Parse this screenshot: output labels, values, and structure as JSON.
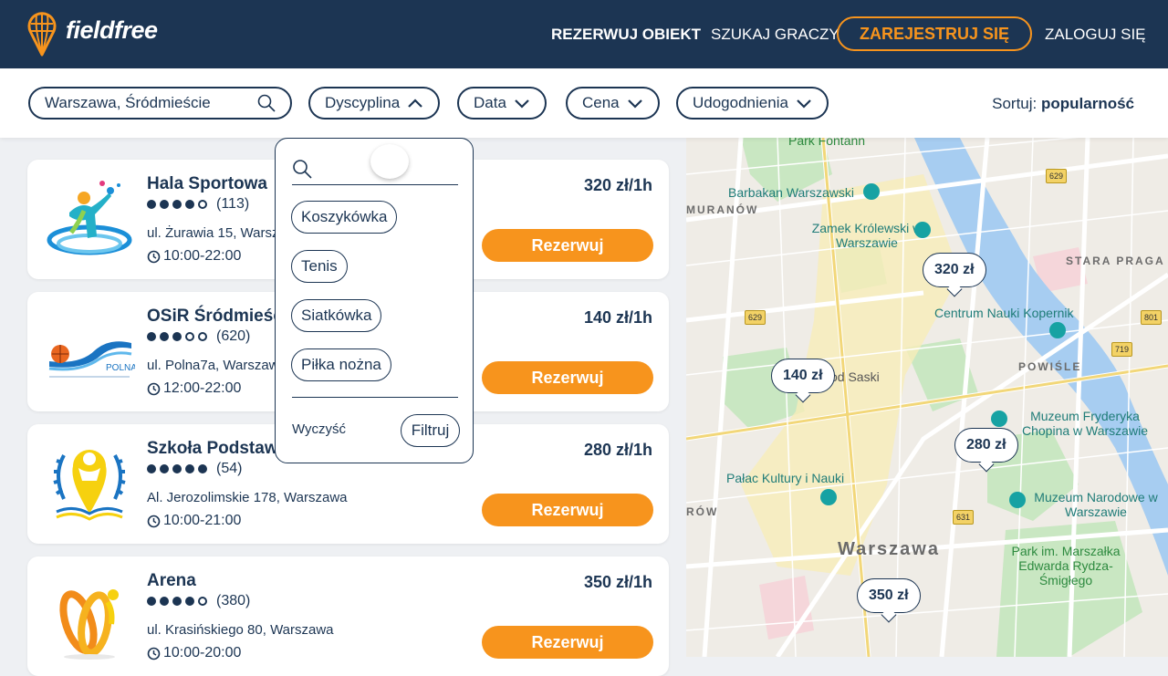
{
  "header": {
    "brand": "fieldfree",
    "nav_rezerwuj": "REZERWUJ OBIEKT",
    "nav_szukaj": "SZUKAJ GRACZY",
    "nav_register": "ZAREJESTRUJ SIĘ",
    "nav_login": "ZALOGUJ SIĘ"
  },
  "filters": {
    "location": "Warszawa, Śródmieście",
    "discipline": "Dyscyplina",
    "date": "Data",
    "price": "Cena",
    "amenities": "Udogodnienia",
    "sort_label": "Sortuj:",
    "sort_value": "popularność"
  },
  "dropdown": {
    "options": [
      "Koszykówka",
      "Tenis",
      "Siatkówka",
      "Piłka nożna"
    ],
    "clear": "Wyczyść",
    "filter": "Filtruj"
  },
  "venues": [
    {
      "name": "Hala Sportowa",
      "stars": 4,
      "reviews": "(113)",
      "address": "ul. Żurawia 15, Warszawa",
      "hours": "10:00-22:00",
      "price": "320 zł/1h",
      "button": "Rezerwuj"
    },
    {
      "name": "OSiR Śródmieście",
      "stars": 3,
      "reviews": "(620)",
      "address": "ul. Polna7a, Warszawa",
      "hours": "12:00-22:00",
      "price": "140 zł/1h",
      "button": "Rezerwuj",
      "logo_text": "POLNA"
    },
    {
      "name": "Szkoła Podstawowa",
      "stars": 5,
      "reviews": "(54)",
      "address": "Al. Jerozolimskie 178, Warszawa",
      "hours": "10:00-21:00",
      "price": "280 zł/1h",
      "button": "Rezerwuj"
    },
    {
      "name": "Arena",
      "stars": 4,
      "reviews": "(380)",
      "address": "ul. Krasińskiego 80, Warszawa",
      "hours": "10:00-20:00",
      "price": "350 zł/1h",
      "button": "Rezerwuj"
    }
  ],
  "map": {
    "pins": [
      "320 zł",
      "140 zł",
      "280 zł",
      "350 zł"
    ],
    "labels": {
      "park_fontann": "Park Fontann",
      "barbakan": "Barbakan Warszawski",
      "zamek": "Zamek Królewski w Warszawie",
      "muranow": "MURANÓW",
      "stara_praga": "STARA PRAGA",
      "centrum_nauki": "Centrum Nauki Kopernik",
      "ogrod_saski": "od Saski",
      "powisle": "POWIŚLE",
      "muzeum_chopina": "Muzeum Fryderyka Chopina w Warszawie",
      "palac": "Pałac Kultury i Nauki",
      "muzeum_narodowe": "Muzeum Narodowe w Warszawie",
      "warszawa": "Warszawa",
      "row": "RÓW",
      "park_rydza": "Park im. Marszałka Edwarda Rydza-Śmigłego",
      "road_629a": "629",
      "road_629b": "629",
      "road_801": "801",
      "road_719": "719",
      "road_631": "631"
    }
  }
}
